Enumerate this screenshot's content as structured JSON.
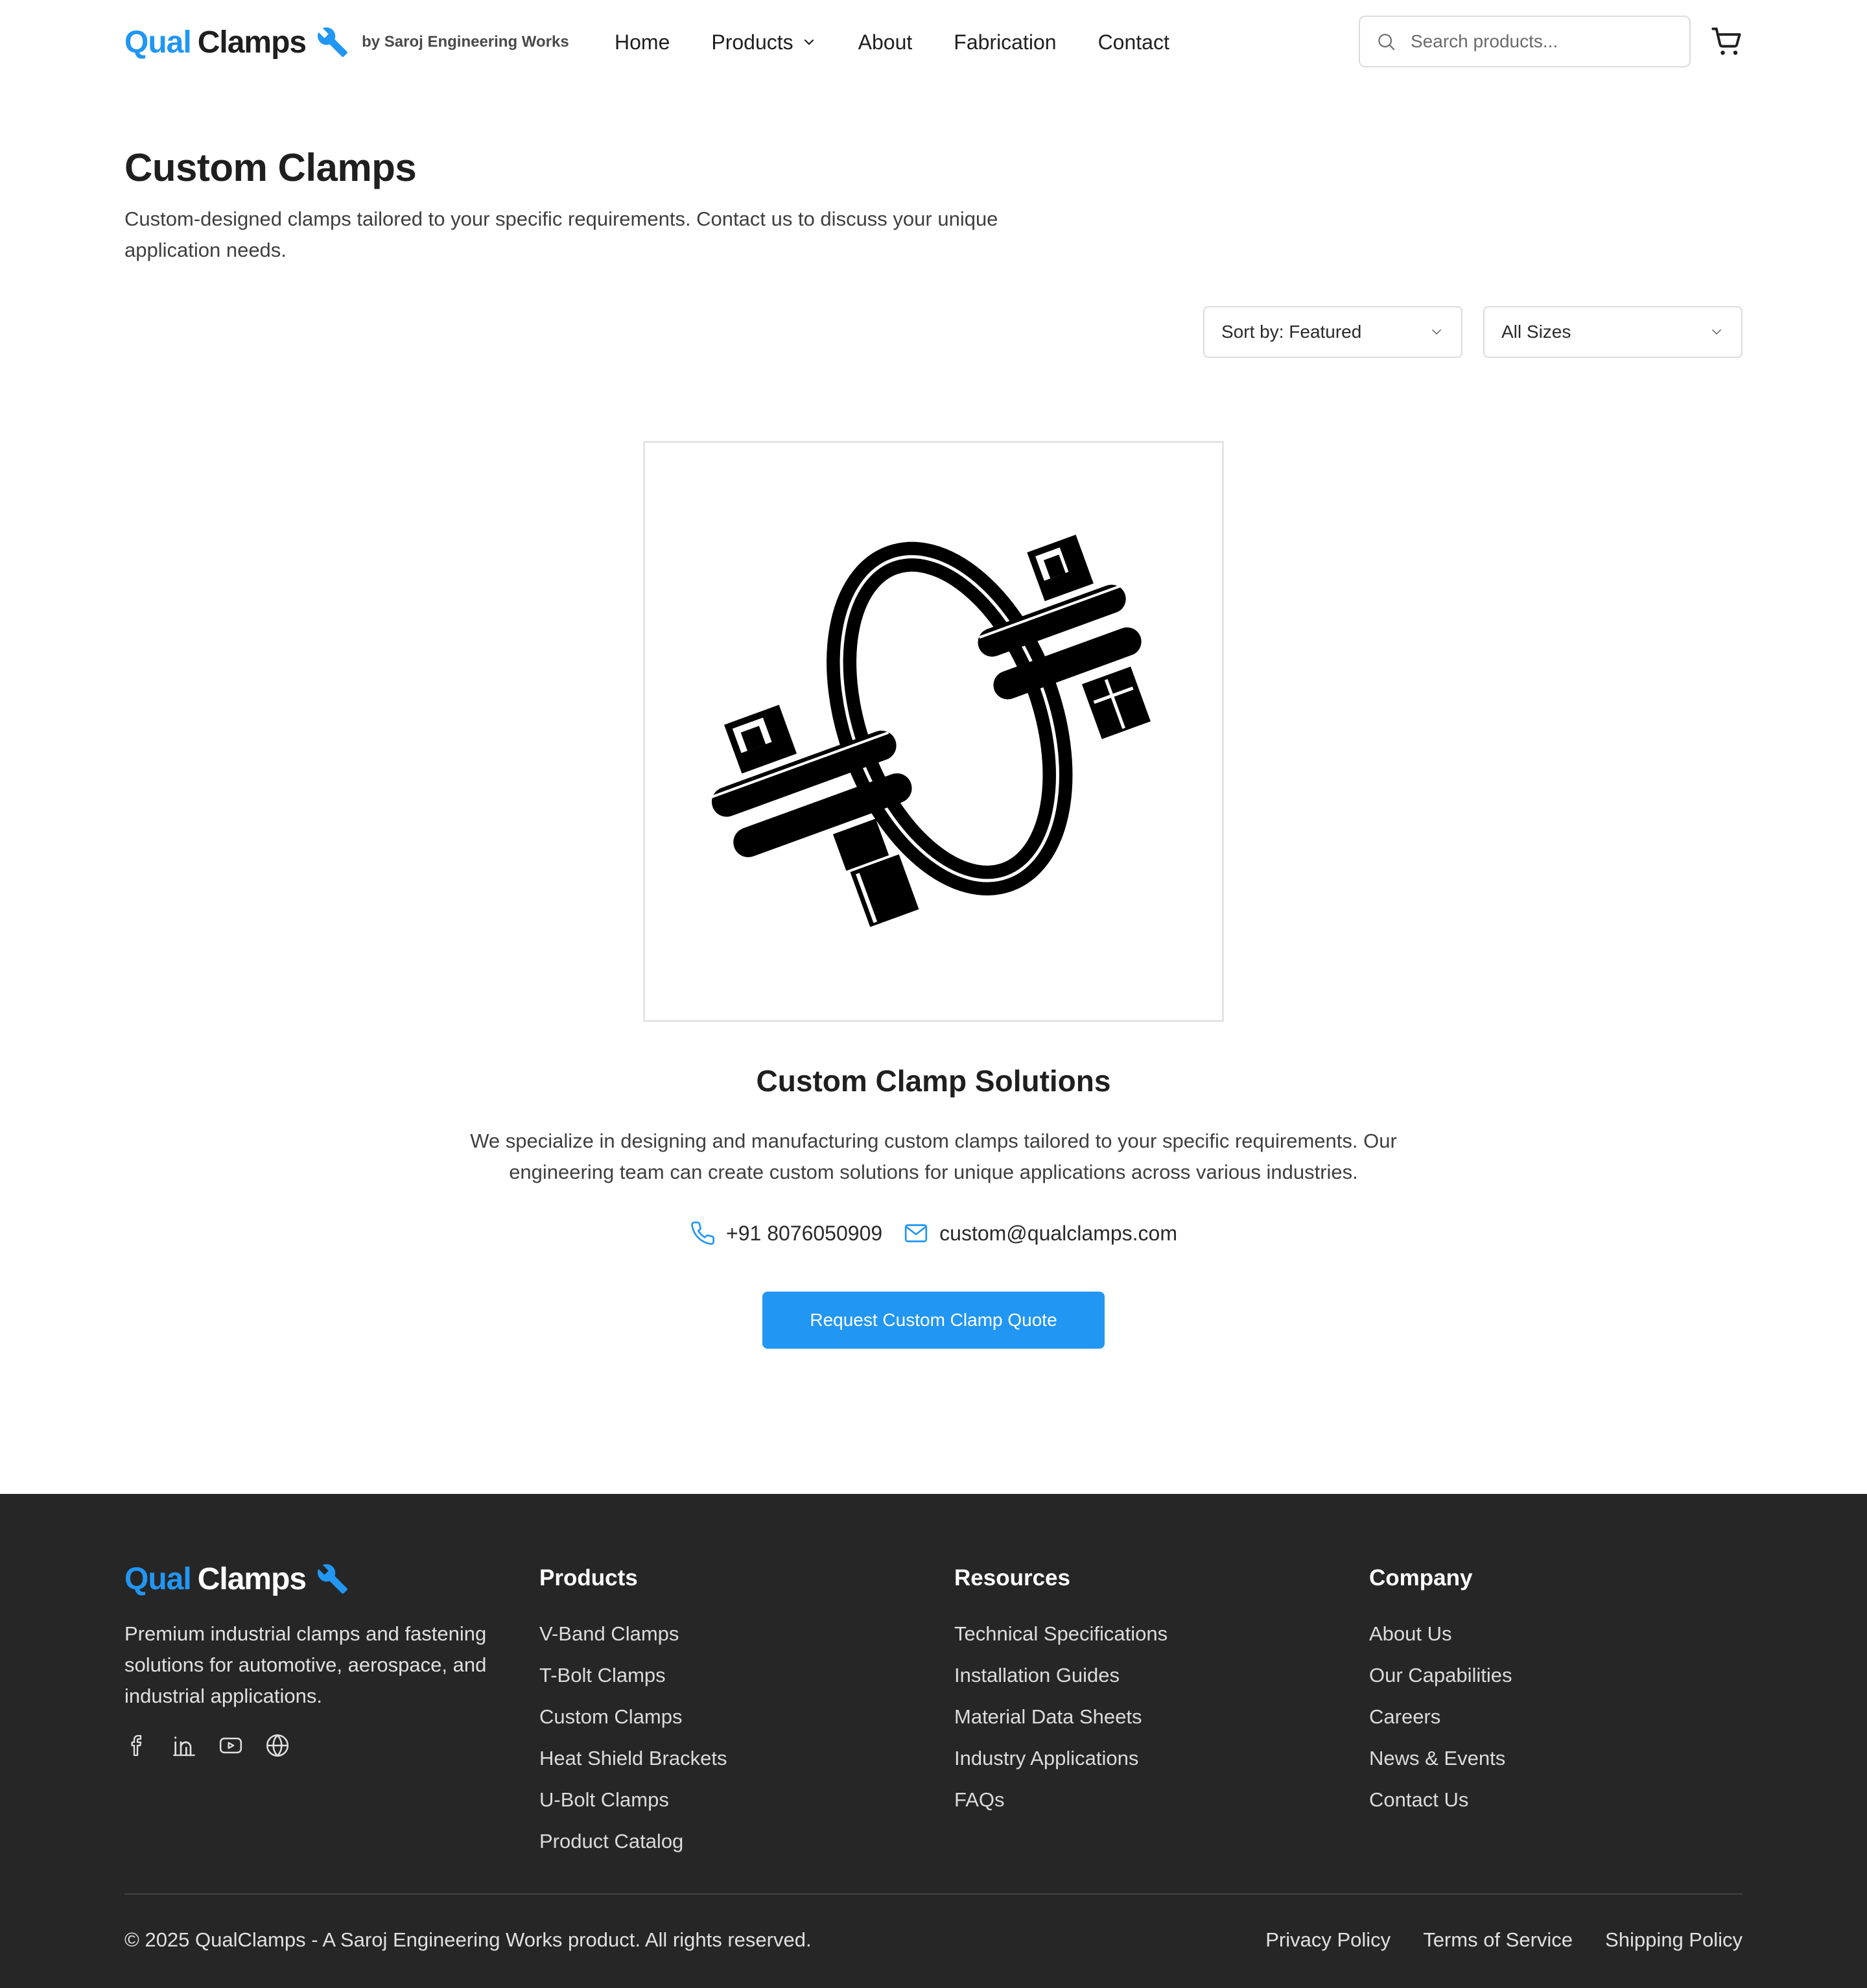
{
  "brand": {
    "name_part1": "Qual",
    "name_part2": "Clamps",
    "tagline": "by Saroj Engineering Works",
    "accent_color": "#2196f3"
  },
  "nav": {
    "items": [
      {
        "label": "Home"
      },
      {
        "label": "Products",
        "has_dropdown": true
      },
      {
        "label": "About"
      },
      {
        "label": "Fabrication"
      },
      {
        "label": "Contact"
      }
    ]
  },
  "search": {
    "placeholder": "Search products...",
    "icon": "search-icon"
  },
  "cart": {
    "icon": "cart-icon"
  },
  "page": {
    "title": "Custom Clamps",
    "description": "Custom-designed clamps tailored to your specific requirements. Contact us to discuss your unique application needs."
  },
  "filters": {
    "sort_selected": "Sort by: Featured",
    "size_selected": "All Sizes"
  },
  "product": {
    "image_icon": "exhaust-clamp-image",
    "title": "Custom Clamp Solutions",
    "description": "We specialize in designing and manufacturing custom clamps tailored to your specific requirements. Our engineering team can create custom solutions for unique applications across various industries.",
    "phone": "+91 8076050909",
    "email": "custom@qualclamps.com",
    "cta_label": "Request Custom Clamp Quote"
  },
  "footer": {
    "about": "Premium industrial clamps and fastening solutions for automotive, aerospace, and industrial applications.",
    "socials": [
      "facebook-icon",
      "linkedin-icon",
      "youtube-icon",
      "globe-icon"
    ],
    "columns": [
      {
        "heading": "Products",
        "links": [
          "V-Band Clamps",
          "T-Bolt Clamps",
          "Custom Clamps",
          "Heat Shield Brackets",
          "U-Bolt Clamps",
          "Product Catalog"
        ]
      },
      {
        "heading": "Resources",
        "links": [
          "Technical Specifications",
          "Installation Guides",
          "Material Data Sheets",
          "Industry Applications",
          "FAQs"
        ]
      },
      {
        "heading": "Company",
        "links": [
          "About Us",
          "Our Capabilities",
          "Careers",
          "News & Events",
          "Contact Us"
        ]
      }
    ],
    "copyright": "© 2025 QualClamps - A Saroj Engineering Works product. All rights reserved.",
    "legal": [
      "Privacy Policy",
      "Terms of Service",
      "Shipping Policy"
    ],
    "background": "#262626"
  }
}
